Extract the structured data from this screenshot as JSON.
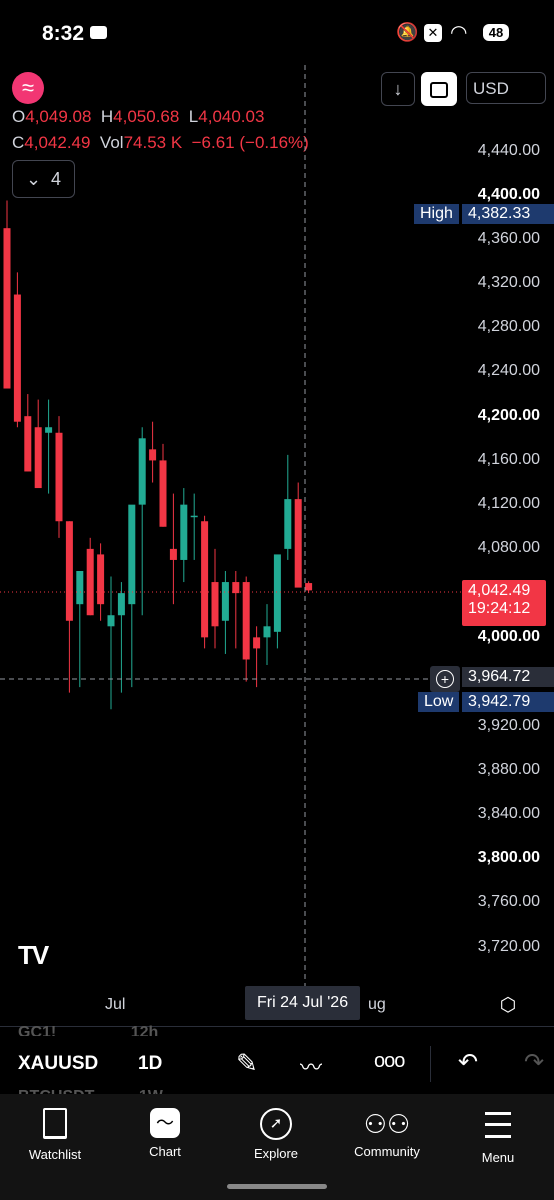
{
  "status_bar": {
    "time": "8:32",
    "battery": "48"
  },
  "header": {
    "logo_glyph": "≈",
    "currency": "USD",
    "indicators_count": "4",
    "ohlc": {
      "o_label": "O",
      "o_value": "4,049.08",
      "h_label": "H",
      "h_value": "4,050.68",
      "l_label": "L",
      "l_value": "4,040.03",
      "c_label": "C",
      "c_value": "4,042.49",
      "vol_label": "Vol",
      "vol_value": "74.53 K",
      "change": "−6.61 (−0.16%)"
    }
  },
  "price_axis": {
    "ticks": [
      "4,440.00",
      "4,400.00",
      "4,360.00",
      "4,320.00",
      "4,280.00",
      "4,240.00",
      "4,200.00",
      "4,160.00",
      "4,120.00",
      "4,080.00",
      "4,000.00",
      "3,920.00",
      "3,880.00",
      "3,840.00",
      "3,800.00",
      "3,760.00",
      "3,720.00"
    ],
    "high_label": "High",
    "high_value": "4,382.33",
    "current_price": "4,042.49",
    "countdown": "19:24:12",
    "crosshair_price": "3,964.72",
    "low_label": "Low",
    "low_value": "3,942.79"
  },
  "time_axis": {
    "jul_label": "Jul",
    "aug_label": "ug",
    "crosshair_date": "Fri 24 Jul '26"
  },
  "watermark": "TV",
  "symbols": {
    "above": {
      "symbol": "GC1!",
      "interval": "12h"
    },
    "current": {
      "symbol": "XAUUSD",
      "interval": "1D"
    },
    "below": {
      "symbol": "BTCUSDT",
      "interval": "1W"
    }
  },
  "nav": {
    "watchlist": "Watchlist",
    "chart": "Chart",
    "explore": "Explore",
    "community": "Community",
    "menu": "Menu"
  },
  "colors": {
    "up": "#22ab94",
    "down": "#f23645",
    "high_tag": "#1e3a6e",
    "price_tag": "#f23645"
  },
  "chart_data": {
    "type": "candlestick",
    "ylim": [
      3700,
      4460
    ],
    "candles": [
      {
        "o": 4370,
        "h": 4395,
        "l": 4320,
        "c": 4225
      },
      {
        "o": 4310,
        "h": 4330,
        "l": 4190,
        "c": 4195
      },
      {
        "o": 4200,
        "h": 4220,
        "l": 4150,
        "c": 4150
      },
      {
        "o": 4190,
        "h": 4215,
        "l": 4140,
        "c": 4135
      },
      {
        "o": 4185,
        "h": 4215,
        "l": 4130,
        "c": 4190
      },
      {
        "o": 4185,
        "h": 4200,
        "l": 4090,
        "c": 4105
      },
      {
        "o": 4105,
        "h": 4105,
        "l": 3950,
        "c": 4015
      },
      {
        "o": 4030,
        "h": 4045,
        "l": 3955,
        "c": 4060
      },
      {
        "o": 4080,
        "h": 4090,
        "l": 4020,
        "c": 4020
      },
      {
        "o": 4075,
        "h": 4085,
        "l": 4015,
        "c": 4030
      },
      {
        "o": 4010,
        "h": 4055,
        "l": 3935,
        "c": 4020
      },
      {
        "o": 4020,
        "h": 4050,
        "l": 3950,
        "c": 4040
      },
      {
        "o": 4030,
        "h": 4100,
        "l": 3955,
        "c": 4120
      },
      {
        "o": 4120,
        "h": 4190,
        "l": 4020,
        "c": 4180
      },
      {
        "o": 4170,
        "h": 4195,
        "l": 4140,
        "c": 4160
      },
      {
        "o": 4160,
        "h": 4175,
        "l": 4100,
        "c": 4100
      },
      {
        "o": 4080,
        "h": 4130,
        "l": 4030,
        "c": 4070
      },
      {
        "o": 4070,
        "h": 4135,
        "l": 4050,
        "c": 4120
      },
      {
        "o": 4110,
        "h": 4130,
        "l": 4070,
        "c": 4110
      },
      {
        "o": 4105,
        "h": 4110,
        "l": 3990,
        "c": 4000
      },
      {
        "o": 4050,
        "h": 4080,
        "l": 3990,
        "c": 4010
      },
      {
        "o": 4015,
        "h": 4060,
        "l": 3985,
        "c": 4050
      },
      {
        "o": 4050,
        "h": 4060,
        "l": 3990,
        "c": 4040
      },
      {
        "o": 4050,
        "h": 4055,
        "l": 3960,
        "c": 3980
      },
      {
        "o": 4000,
        "h": 4010,
        "l": 3955,
        "c": 3990
      },
      {
        "o": 4000,
        "h": 4030,
        "l": 3975,
        "c": 4010
      },
      {
        "o": 4005,
        "h": 4070,
        "l": 3990,
        "c": 4075
      },
      {
        "o": 4080,
        "h": 4165,
        "l": 4070,
        "c": 4125
      },
      {
        "o": 4125,
        "h": 4140,
        "l": 4060,
        "c": 4045
      },
      {
        "o": 4049.08,
        "h": 4050.68,
        "l": 4040.03,
        "c": 4042.49
      }
    ]
  }
}
